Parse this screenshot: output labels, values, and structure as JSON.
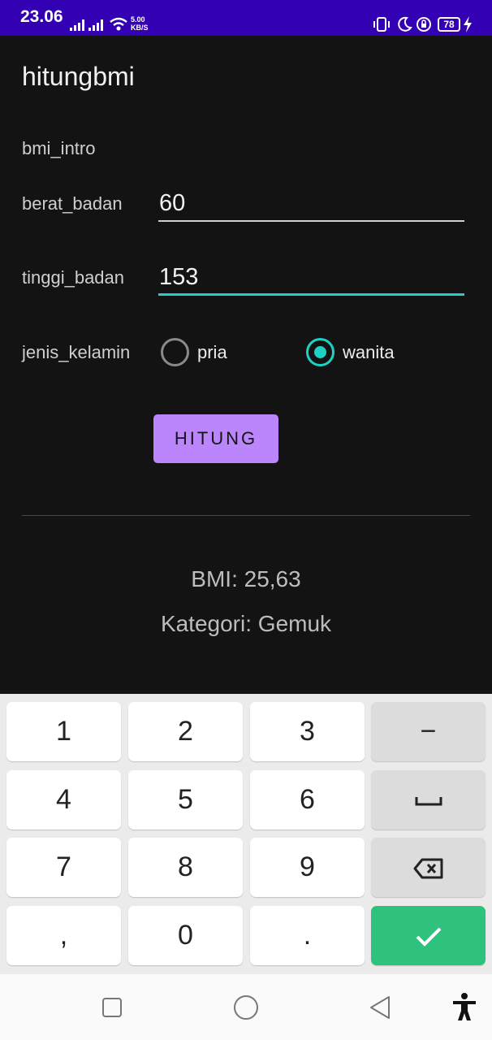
{
  "status_bar": {
    "time": "23.06",
    "net_speed_value": "5.00",
    "net_speed_unit": "KB/S",
    "battery": "78",
    "icons": [
      "signal-icon",
      "signal-icon",
      "wifi-icon",
      "vibrate-icon",
      "do-not-disturb-icon",
      "rotation-lock-icon",
      "battery-icon",
      "charging-icon"
    ]
  },
  "app": {
    "title": "hitungbmi",
    "intro": "bmi_intro",
    "berat_label": "berat_badan",
    "berat_value": "60",
    "tinggi_label": "tinggi_badan",
    "tinggi_value": "153",
    "jenis_label": "jenis_kelamin",
    "radio_pria": "pria",
    "radio_wanita": "wanita",
    "selected_gender": "wanita",
    "button_label": "HITUNG",
    "result_bmi": "BMI: 25,63",
    "result_kategori": "Kategori: Gemuk"
  },
  "keyboard": {
    "rows": [
      [
        "1",
        "2",
        "3",
        "−"
      ],
      [
        "4",
        "5",
        "6",
        "space"
      ],
      [
        "7",
        "8",
        "9",
        "backspace"
      ],
      [
        ",",
        "0",
        ".",
        "done"
      ]
    ],
    "k1": "1",
    "k2": "2",
    "k3": "3",
    "minus": "−",
    "k4": "4",
    "k5": "5",
    "k6": "6",
    "k7": "7",
    "k8": "8",
    "k9": "9",
    "comma": ",",
    "k0": "0",
    "period": "."
  },
  "nav": {
    "icons": [
      "recents-icon",
      "home-icon",
      "back-icon",
      "accessibility-icon"
    ]
  },
  "colors": {
    "status_bar": "#3300b3",
    "background": "#131313",
    "accent": "#1dd2c4",
    "button": "#bb86fc",
    "done_key": "#2ec27e"
  }
}
